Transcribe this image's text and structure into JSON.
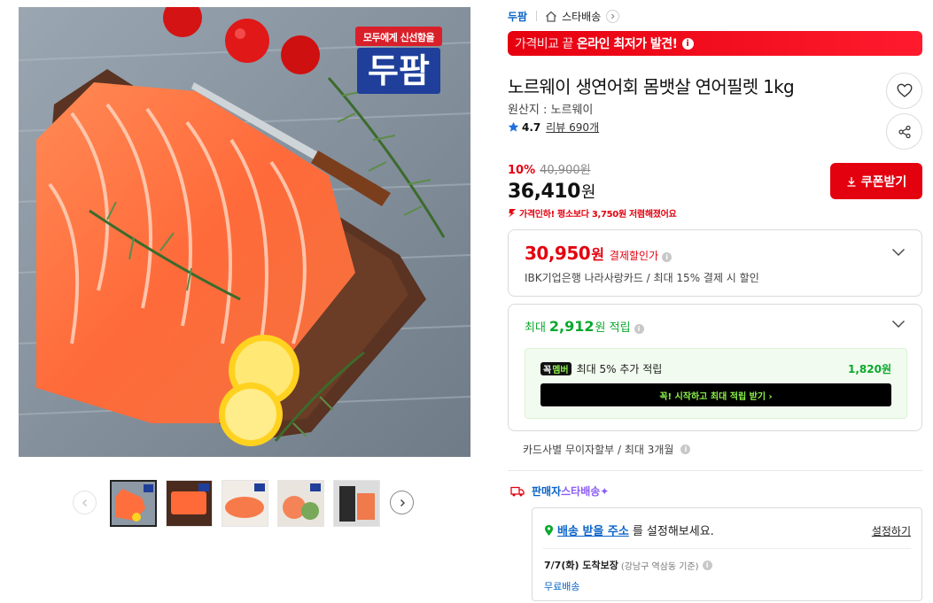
{
  "gallery": {
    "brand_badge_top": "모두에게 신선함을",
    "brand_badge_main": "두팜",
    "thumbnail_count": 5,
    "active_thumbnail": 1
  },
  "breadcrumb": {
    "brand": "두팜",
    "category": "스타배송"
  },
  "promo": {
    "light_text": "가격비교 끝",
    "bold_text": "온라인 최저가 발견!"
  },
  "product": {
    "title": "노르웨이 생연어회 몸뱃살 연어필렛 1kg",
    "origin": "원산지 : 노르웨이",
    "rating": "4.7",
    "review_count": "리뷰 690개"
  },
  "price": {
    "discount_rate": "10%",
    "original": "40,900원",
    "sale": "36,410",
    "sale_unit": "원",
    "drop_notice": "가격인하! 평소보다 3,750원 저렴해졌어요"
  },
  "coupon": {
    "label": "쿠폰받기"
  },
  "card_discount": {
    "price": "30,950",
    "unit": "원",
    "label": "결제할인가",
    "description": "IBK기업은행 나라사랑카드 / 최대 15% 결제 시 할인"
  },
  "reward": {
    "prefix": "최대",
    "amount": "2,912",
    "unit": "원 적립",
    "member_badge_a": "꼭",
    "member_badge_b": "멤버",
    "member_text": "최대 5% 추가 적립",
    "member_amount": "1,820원",
    "member_cta": "꼭! 시작하고 최대 적립 받기  ›"
  },
  "installment": {
    "text": "카드사별 무이자할부 / 최대 3개월"
  },
  "delivery": {
    "label_a": "판매자",
    "label_b": "스타배송✦",
    "address_link": "배송 받을 주소",
    "address_rest": "를 설정해보세요.",
    "set_label": "설정하기",
    "eta_date": "7/7(화) 도착보장",
    "eta_note": "(강남구 역삼동 기준)",
    "shipping_fee": "무료배송"
  },
  "colors": {
    "accent_red": "#e3000f",
    "link_blue": "#0a64c8",
    "reward_green": "#0aa82c",
    "member_lime": "#8bf34a"
  }
}
